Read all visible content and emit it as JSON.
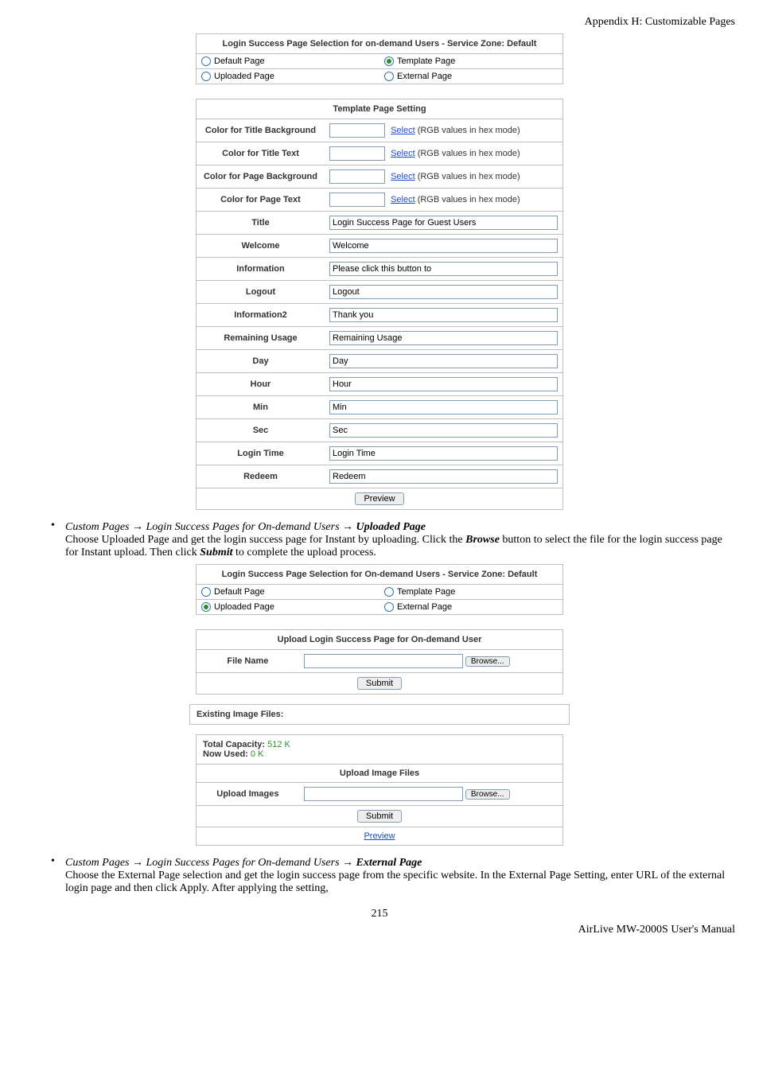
{
  "header": {
    "appendix": "Appendix H:   Customizable Pages"
  },
  "panel1": {
    "title": "Login Success Page Selection for on-demand Users - Service Zone: Default",
    "options": {
      "default": "Default Page",
      "template": "Template Page",
      "uploaded": "Uploaded Page",
      "external": "External Page"
    },
    "selected": "template"
  },
  "templateSettings": {
    "title": "Template Page Setting",
    "hex_hint": "(RGB values in hex mode)",
    "select": "Select",
    "rows": {
      "title_bg": "Color for Title Background",
      "title_text": "Color for Title Text",
      "page_bg": "Color for Page Background",
      "page_text": "Color for Page Text",
      "title": "Title",
      "welcome": "Welcome",
      "information": "Information",
      "logout": "Logout",
      "information2": "Information2",
      "remaining_usage": "Remaining Usage",
      "day": "Day",
      "hour": "Hour",
      "min": "Min",
      "sec": "Sec",
      "login_time": "Login Time",
      "redeem": "Redeem"
    },
    "values": {
      "title": "Login Success Page for Guest Users",
      "welcome": "Welcome",
      "information": "Please click this button to",
      "logout": "Logout",
      "information2": "Thank you",
      "remaining_usage": "Remaining Usage",
      "day": "Day",
      "hour": "Hour",
      "min": "Min",
      "sec": "Sec",
      "login_time": "Login Time",
      "redeem": "Redeem"
    },
    "preview": "Preview"
  },
  "bullet_uploaded": {
    "path1": "Custom Pages",
    "path2": "Login Success Pages for On-demand Users",
    "path3": "Uploaded Page",
    "arrow": "→",
    "body": "Choose Uploaded Page and get the login success page for Instant by uploading. Click the ",
    "browse_word": "Browse",
    "body2": " button to select the file for the login success page for Instant upload. Then click ",
    "submit_word": "Submit",
    "body3": " to complete the upload process."
  },
  "panel2": {
    "title": "Login Success Page Selection for On-demand Users - Service Zone: Default",
    "options": {
      "default": "Default Page",
      "template": "Template Page",
      "uploaded": "Uploaded Page",
      "external": "External Page"
    },
    "selected": "uploaded"
  },
  "uploadPanel": {
    "title": "Upload Login Success Page for On-demand User",
    "file_name_label": "File Name",
    "browse": "Browse...",
    "submit": "Submit"
  },
  "existing_files": {
    "label": "Existing Image Files:"
  },
  "capacity": {
    "total_label": "Total Capacity:",
    "total_val": "512 K",
    "used_label": "Now Used:",
    "used_val": "0 K"
  },
  "uploadImages": {
    "title": "Upload Image Files",
    "label": "Upload Images",
    "browse": "Browse...",
    "submit": "Submit",
    "preview": "Preview"
  },
  "bullet_external": {
    "path1": "Custom Pages",
    "path2": "Login Success Pages for On-demand Users",
    "path3": "External Page",
    "arrow": "→",
    "body": "Choose the External Page selection and get the login success page from the specific website. In the External Page Setting, enter URL of the external login page and then click Apply. After applying the setting,"
  },
  "page_number": "215",
  "footer": "AirLive MW-2000S  User's  Manual"
}
